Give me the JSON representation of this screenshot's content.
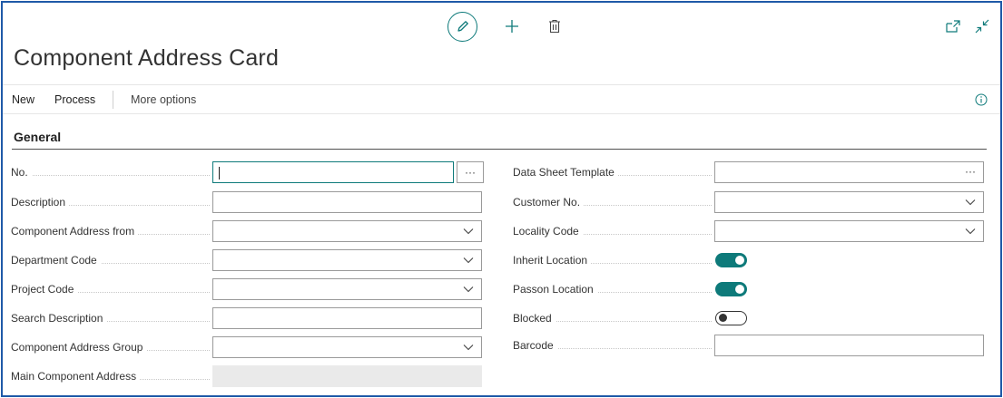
{
  "page": {
    "title": "Component Address Card",
    "accent_color": "#0e7a7a",
    "border_color": "#1f5aa8"
  },
  "top_actions": {
    "icons": [
      "edit-pencil-icon",
      "plus-icon",
      "trash-icon"
    ],
    "window_icons": [
      "open-new-window-icon",
      "collapse-icon"
    ]
  },
  "menu": {
    "new_label": "New",
    "process_label": "Process",
    "more_label": "More options",
    "info_icon": "info-icon"
  },
  "section": {
    "title": "General"
  },
  "left_fields": [
    {
      "label": "No.",
      "value": "",
      "type": "text-with-assist"
    },
    {
      "label": "Description",
      "value": "",
      "type": "text"
    },
    {
      "label": "Component Address from",
      "value": "",
      "type": "dropdown"
    },
    {
      "label": "Department Code",
      "value": "",
      "type": "dropdown"
    },
    {
      "label": "Project Code",
      "value": "",
      "type": "dropdown"
    },
    {
      "label": "Search Description",
      "value": "",
      "type": "text"
    },
    {
      "label": "Component Address Group",
      "value": "",
      "type": "dropdown"
    },
    {
      "label": "Main Component Address",
      "value": "",
      "type": "disabled"
    }
  ],
  "right_fields": [
    {
      "label": "Data Sheet Template",
      "value": "",
      "type": "lookup"
    },
    {
      "label": "Customer No.",
      "value": "",
      "type": "dropdown"
    },
    {
      "label": "Locality Code",
      "value": "",
      "type": "dropdown"
    },
    {
      "label": "Inherit Location",
      "value": true,
      "type": "toggle"
    },
    {
      "label": "Passon Location",
      "value": true,
      "type": "toggle"
    },
    {
      "label": "Blocked",
      "value": false,
      "type": "toggle"
    },
    {
      "label": "Barcode",
      "value": "",
      "type": "text"
    }
  ],
  "assist_button_label": "···"
}
